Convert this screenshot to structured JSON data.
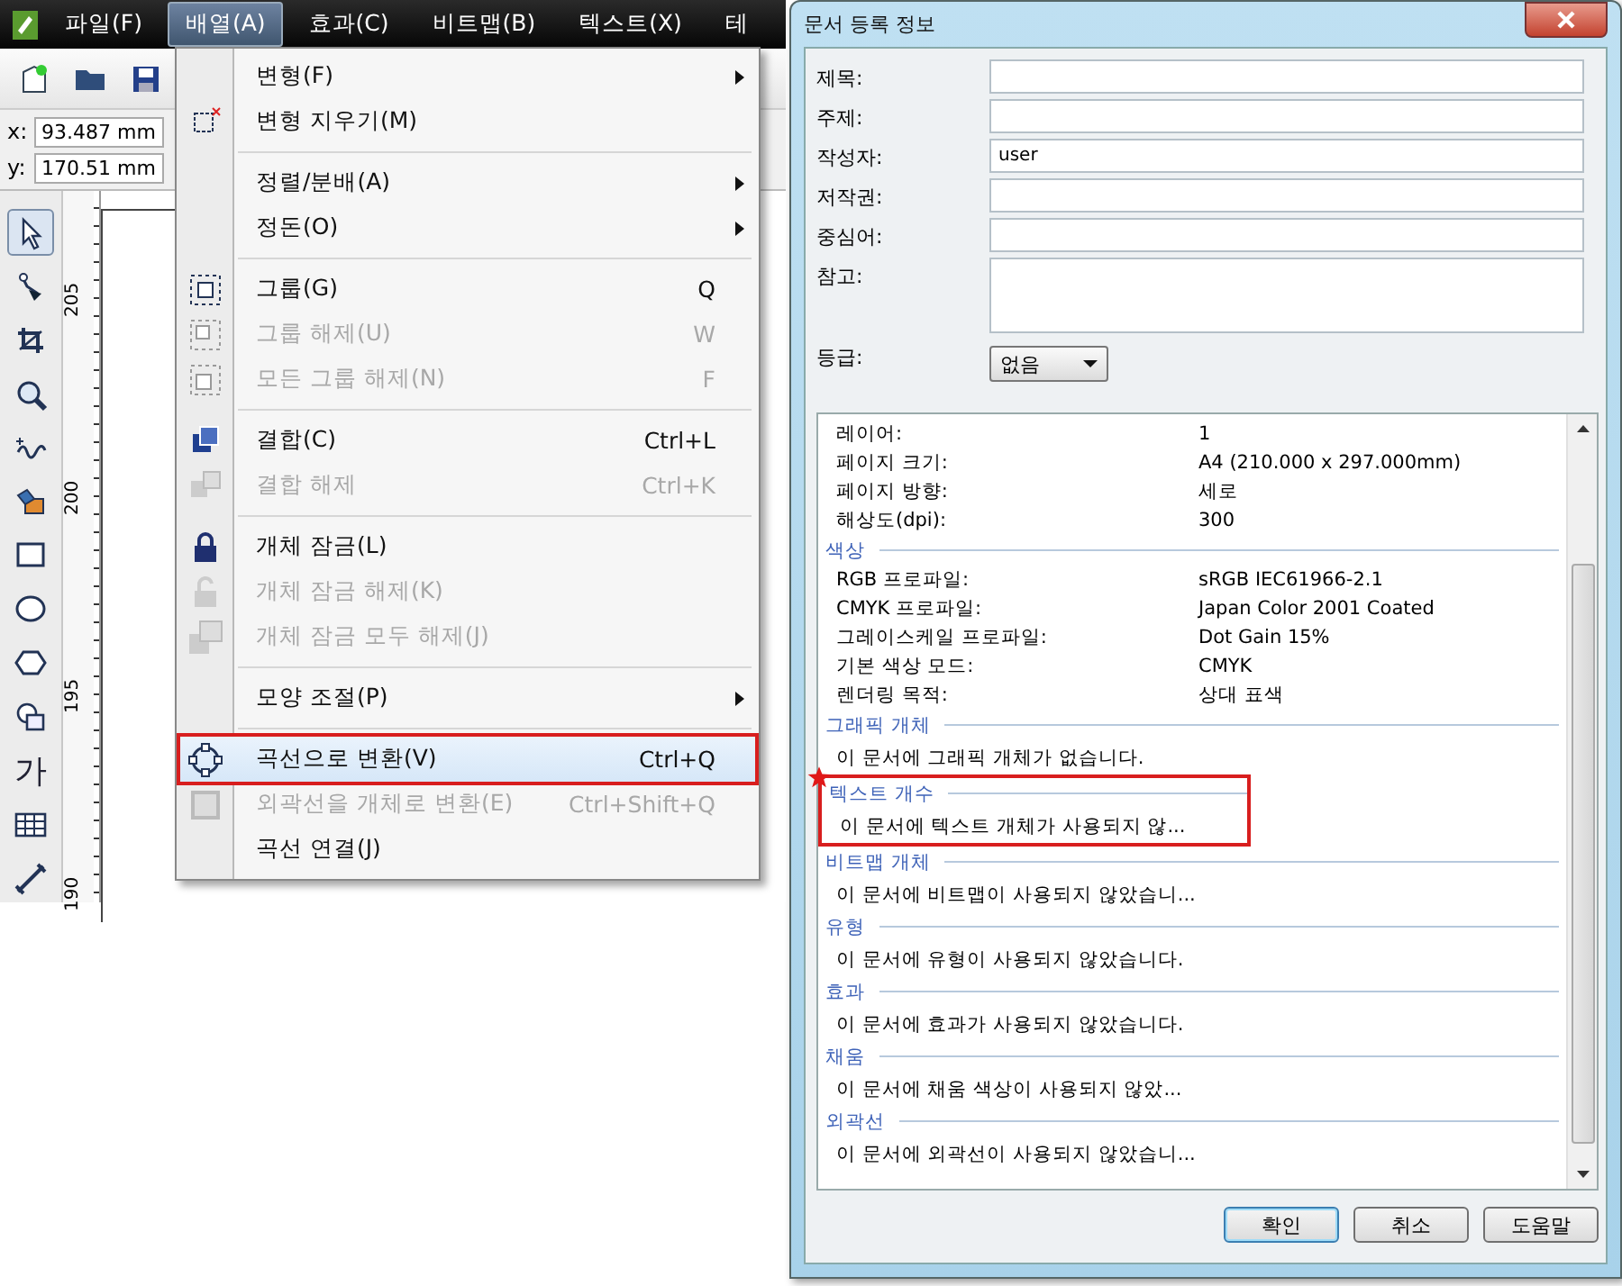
{
  "app": {
    "menu_bar": [
      {
        "label": "파일(F)",
        "selected": false
      },
      {
        "label": "배열(A)",
        "selected": true
      },
      {
        "label": "효과(C)",
        "selected": false
      },
      {
        "label": "비트맵(B)",
        "selected": false
      },
      {
        "label": "텍스트(X)",
        "selected": false
      },
      {
        "label": "테",
        "selected": false
      }
    ],
    "coordinates": [
      {
        "axis": "x:",
        "value": "93.487 mm"
      },
      {
        "axis": "y:",
        "value": "170.51 mm"
      }
    ],
    "tools": [
      {
        "selected": true
      },
      {
        "selected": false
      },
      {
        "selected": false
      },
      {
        "selected": false
      },
      {
        "selected": false
      },
      {
        "selected": false
      },
      {
        "selected": false
      },
      {
        "selected": false
      },
      {
        "selected": false
      },
      {
        "selected": false
      },
      {
        "label": "가",
        "selected": false
      },
      {
        "selected": false
      },
      {
        "selected": false
      }
    ],
    "ruler_labels": [
      "205",
      "200",
      "195",
      "190"
    ]
  },
  "menu": {
    "items": [
      {
        "kind": "item",
        "label": "변형(F)",
        "submenu": true,
        "disabled": false,
        "selected": false
      },
      {
        "kind": "item",
        "label": "변형 지우기(M)",
        "disabled": false,
        "selected": false
      },
      {
        "kind": "separator"
      },
      {
        "kind": "item",
        "label": "정렬/분배(A)",
        "submenu": true,
        "disabled": false,
        "selected": false
      },
      {
        "kind": "item",
        "label": "정돈(O)",
        "submenu": true,
        "disabled": false,
        "selected": false
      },
      {
        "kind": "separator"
      },
      {
        "kind": "item",
        "label": "그룹(G)",
        "shortcut": "Q",
        "disabled": false,
        "selected": false
      },
      {
        "kind": "item",
        "label": "그룹 해제(U)",
        "shortcut": "W",
        "disabled": true,
        "selected": false
      },
      {
        "kind": "item",
        "label": "모든 그룹 해제(N)",
        "shortcut": "F",
        "disabled": true,
        "selected": false
      },
      {
        "kind": "separator"
      },
      {
        "kind": "item",
        "label": "결합(C)",
        "shortcut": "Ctrl+L",
        "disabled": false,
        "selected": false
      },
      {
        "kind": "item",
        "label": "결합 해제",
        "shortcut": "Ctrl+K",
        "disabled": true,
        "selected": false
      },
      {
        "kind": "separator"
      },
      {
        "kind": "item",
        "label": "개체 잠금(L)",
        "disabled": false,
        "selected": false
      },
      {
        "kind": "item",
        "label": "개체 잠금 해제(K)",
        "disabled": true,
        "selected": false
      },
      {
        "kind": "item",
        "label": "개체 잠금 모두 해제(J)",
        "disabled": true,
        "selected": false
      },
      {
        "kind": "separator"
      },
      {
        "kind": "item",
        "label": "모양 조절(P)",
        "submenu": true,
        "disabled": false,
        "selected": false
      },
      {
        "kind": "separator"
      },
      {
        "kind": "item",
        "label": "곡선으로 변환(V)",
        "shortcut": "Ctrl+Q",
        "disabled": false,
        "selected": true
      },
      {
        "kind": "item",
        "label": "외곽선을 개체로 변환(E)",
        "shortcut": "Ctrl+Shift+Q",
        "disabled": true,
        "selected": false
      },
      {
        "kind": "item",
        "label": "곡선 연결(J)",
        "disabled": false,
        "selected": false
      }
    ]
  },
  "dialog": {
    "title": "문서 등록 정보",
    "fields": [
      {
        "kind": "text",
        "label": "제목:"
      },
      {
        "kind": "text",
        "label": "주제:"
      },
      {
        "kind": "text",
        "label": "작성자:",
        "value": "user"
      },
      {
        "kind": "text",
        "label": "저작권:"
      },
      {
        "kind": "text",
        "label": "중심어:"
      },
      {
        "kind": "multiline",
        "label": "참고:"
      },
      {
        "kind": "select",
        "label": "등급:",
        "value": "없음"
      }
    ],
    "info_sections": [
      {
        "rows": [
          {
            "name": "레이어:",
            "value": "1"
          },
          {
            "name": "페이지 크기:",
            "value": "A4 (210.000 x 297.000mm)"
          },
          {
            "name": "페이지 방향:",
            "value": "세로"
          },
          {
            "name": "해상도(dpi):",
            "value": "300"
          }
        ]
      },
      {
        "heading": "색상",
        "rows": [
          {
            "name": "RGB 프로파일:",
            "value": "sRGB IEC61966-2.1"
          },
          {
            "name": "CMYK 프로파일:",
            "value": "Japan Color 2001 Coated"
          },
          {
            "name": "그레이스케일 프로파일:",
            "value": "Dot Gain 15%"
          },
          {
            "name": "기본 색상 모드:",
            "value": "CMYK"
          },
          {
            "name": "렌더링 목적:",
            "value": "상대 표색"
          }
        ]
      },
      {
        "heading": "그래픽 개체",
        "message": "이 문서에 그래픽 개체가 없습니다.",
        "annotated": false
      },
      {
        "heading": "텍스트 개수",
        "message": "이 문서에 텍스트 개체가 사용되지 않...",
        "annotated": true
      },
      {
        "heading": "비트맵 개체",
        "message": "이 문서에 비트맵이 사용되지 않았습니...",
        "annotated": false
      },
      {
        "heading": "유형",
        "message": "이 문서에 유형이 사용되지 않았습니다.",
        "annotated": false
      },
      {
        "heading": "효과",
        "message": "이 문서에 효과가 사용되지 않았습니다.",
        "annotated": false
      },
      {
        "heading": "채움",
        "message": "이 문서에 채움 색상이 사용되지 않았...",
        "annotated": false
      },
      {
        "heading": "외곽선",
        "message": "이 문서에 외곽선이 사용되지 않았습니...",
        "annotated": false
      }
    ],
    "buttons": [
      {
        "label": "확인",
        "default": true
      },
      {
        "label": "취소",
        "default": false
      },
      {
        "label": "도움말",
        "default": false
      }
    ]
  }
}
